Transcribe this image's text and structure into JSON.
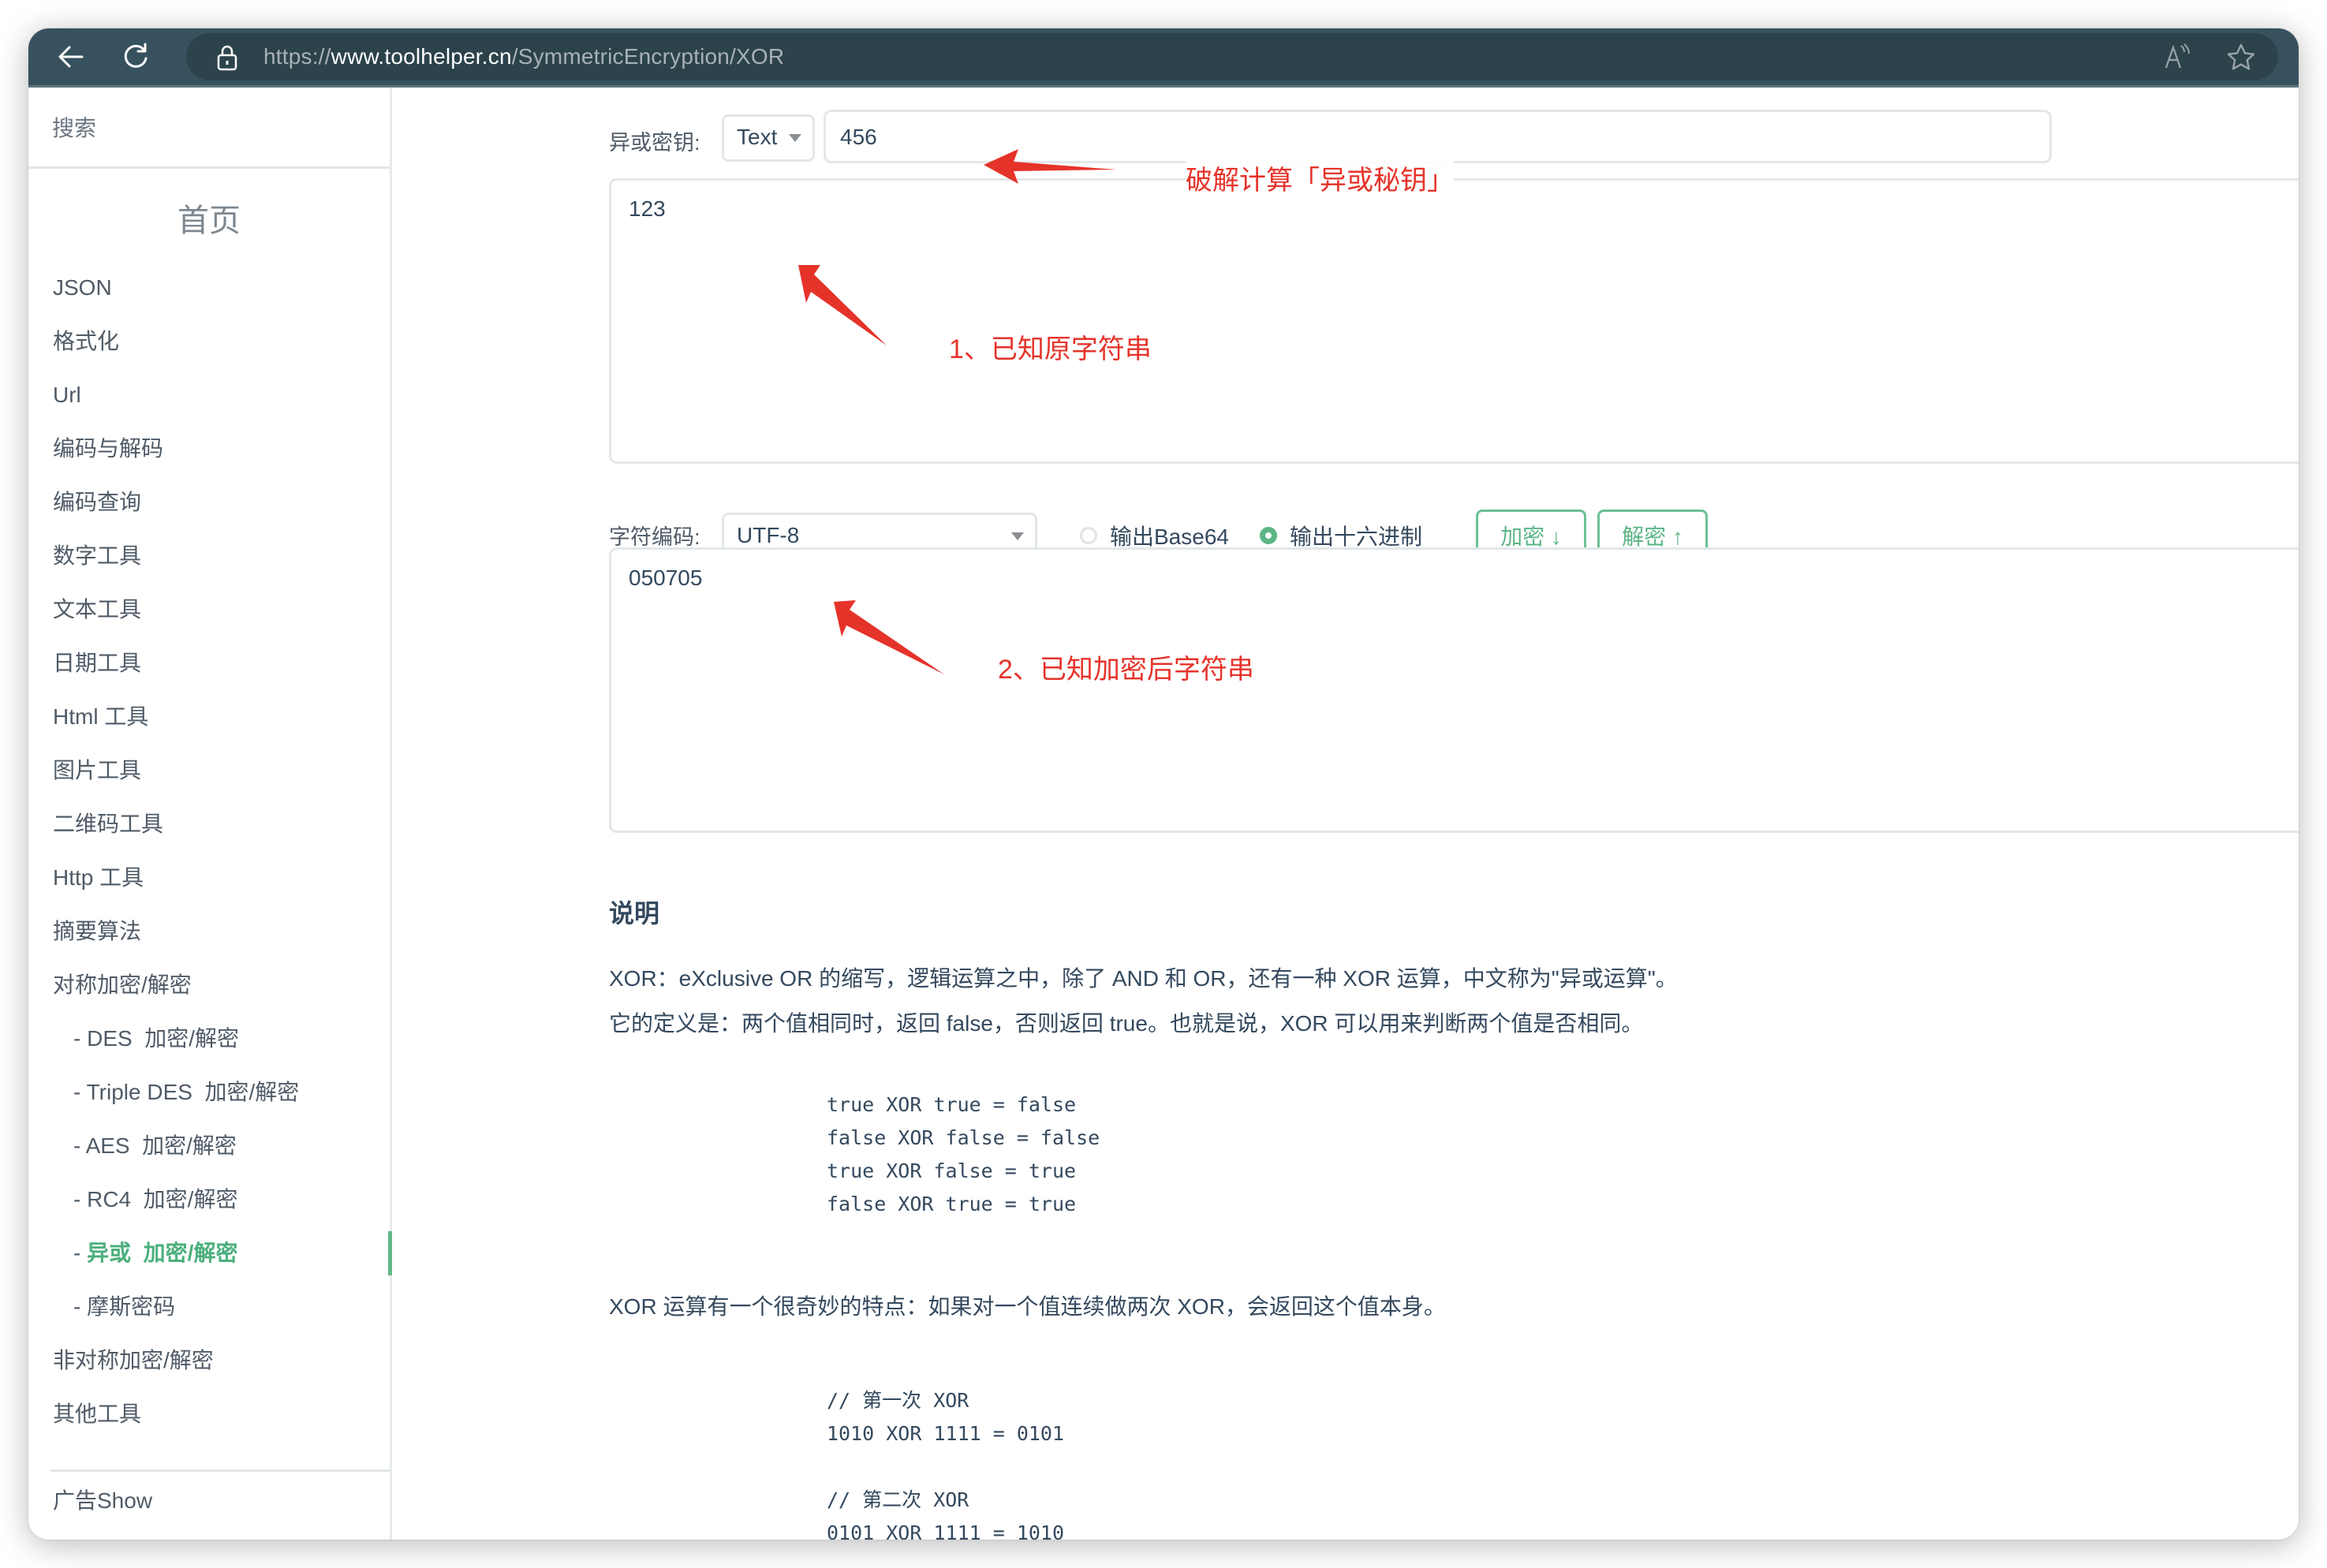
{
  "browser": {
    "url_scheme": "https://",
    "url_host": "www.toolhelper.cn",
    "url_path": "/SymmetricEncryption/XOR",
    "icons": [
      "back-arrow-icon",
      "reload-icon",
      "lock-icon",
      "read-aloud-icon",
      "star-icon"
    ]
  },
  "sidebar": {
    "search_label": "搜索",
    "home_label": "首页",
    "items": [
      {
        "label": "JSON",
        "sub": false,
        "active": false
      },
      {
        "label": "格式化",
        "sub": false,
        "active": false
      },
      {
        "label": "Url",
        "sub": false,
        "active": false
      },
      {
        "label": "编码与解码",
        "sub": false,
        "active": false
      },
      {
        "label": "编码查询",
        "sub": false,
        "active": false
      },
      {
        "label": "数字工具",
        "sub": false,
        "active": false
      },
      {
        "label": "文本工具",
        "sub": false,
        "active": false
      },
      {
        "label": "日期工具",
        "sub": false,
        "active": false
      },
      {
        "label": "Html 工具",
        "sub": false,
        "active": false
      },
      {
        "label": "图片工具",
        "sub": false,
        "active": false
      },
      {
        "label": "二维码工具",
        "sub": false,
        "active": false
      },
      {
        "label": "Http 工具",
        "sub": false,
        "active": false
      },
      {
        "label": "摘要算法",
        "sub": false,
        "active": false
      },
      {
        "label": "对称加密/解密",
        "sub": false,
        "active": false
      },
      {
        "prefix": "- ",
        "label": "DES  加密/解密",
        "sub": true,
        "active": false
      },
      {
        "prefix": "- ",
        "label": "Triple DES  加密/解密",
        "sub": true,
        "active": false
      },
      {
        "prefix": "- ",
        "label": "AES  加密/解密",
        "sub": true,
        "active": false
      },
      {
        "prefix": "- ",
        "label": "RC4  加密/解密",
        "sub": true,
        "active": false
      },
      {
        "prefix": "- ",
        "label": "异或  加密/解密",
        "sub": true,
        "active": true
      },
      {
        "prefix": "- ",
        "label": "摩斯密码",
        "sub": true,
        "active": false
      },
      {
        "label": "非对称加密/解密",
        "sub": false,
        "active": false
      },
      {
        "label": "其他工具",
        "sub": false,
        "active": false
      }
    ],
    "ad_label": "广告Show"
  },
  "form": {
    "key_label": "异或密钥:",
    "key_type": "Text",
    "key_value": "456",
    "plaintext": "123",
    "charset_label": "字符编码:",
    "charset_value": "UTF-8",
    "output_base64_label": "输出Base64",
    "output_hex_label": "输出十六进制",
    "output_selected": "hex",
    "encrypt_label": "加密 ↓",
    "decrypt_label": "解密 ↑",
    "ciphertext": "050705"
  },
  "annotations": {
    "key_note": "破解计算「异或秘钥」",
    "plain_note": "1、已知原字符串",
    "cipher_note": "2、已知加密后字符串",
    "color": "#e5332a"
  },
  "doc": {
    "heading": "说明",
    "p1": "XOR：eXclusive OR 的缩写，逻辑运算之中，除了 AND 和 OR，还有一种 XOR 运算，中文称为\"异或运算\"。",
    "p2": "它的定义是：两个值相同时，返回 false，否则返回 true。也就是说，XOR 可以用来判断两个值是否相同。",
    "truth_table": [
      "true XOR true = false",
      "false XOR false = false",
      "true XOR false = true",
      "false XOR true = true"
    ],
    "p3": "XOR 运算有一个很奇妙的特点：如果对一个值连续做两次 XOR，会返回这个值本身。",
    "code2": [
      "// 第一次 XOR",
      "1010 XOR 1111 = 0101",
      "",
      "// 第二次 XOR",
      "0101 XOR 1111 = 1010"
    ]
  },
  "theme": {
    "accent": "#5cb585",
    "toolbar": "#37525e",
    "text": "#34495e"
  }
}
